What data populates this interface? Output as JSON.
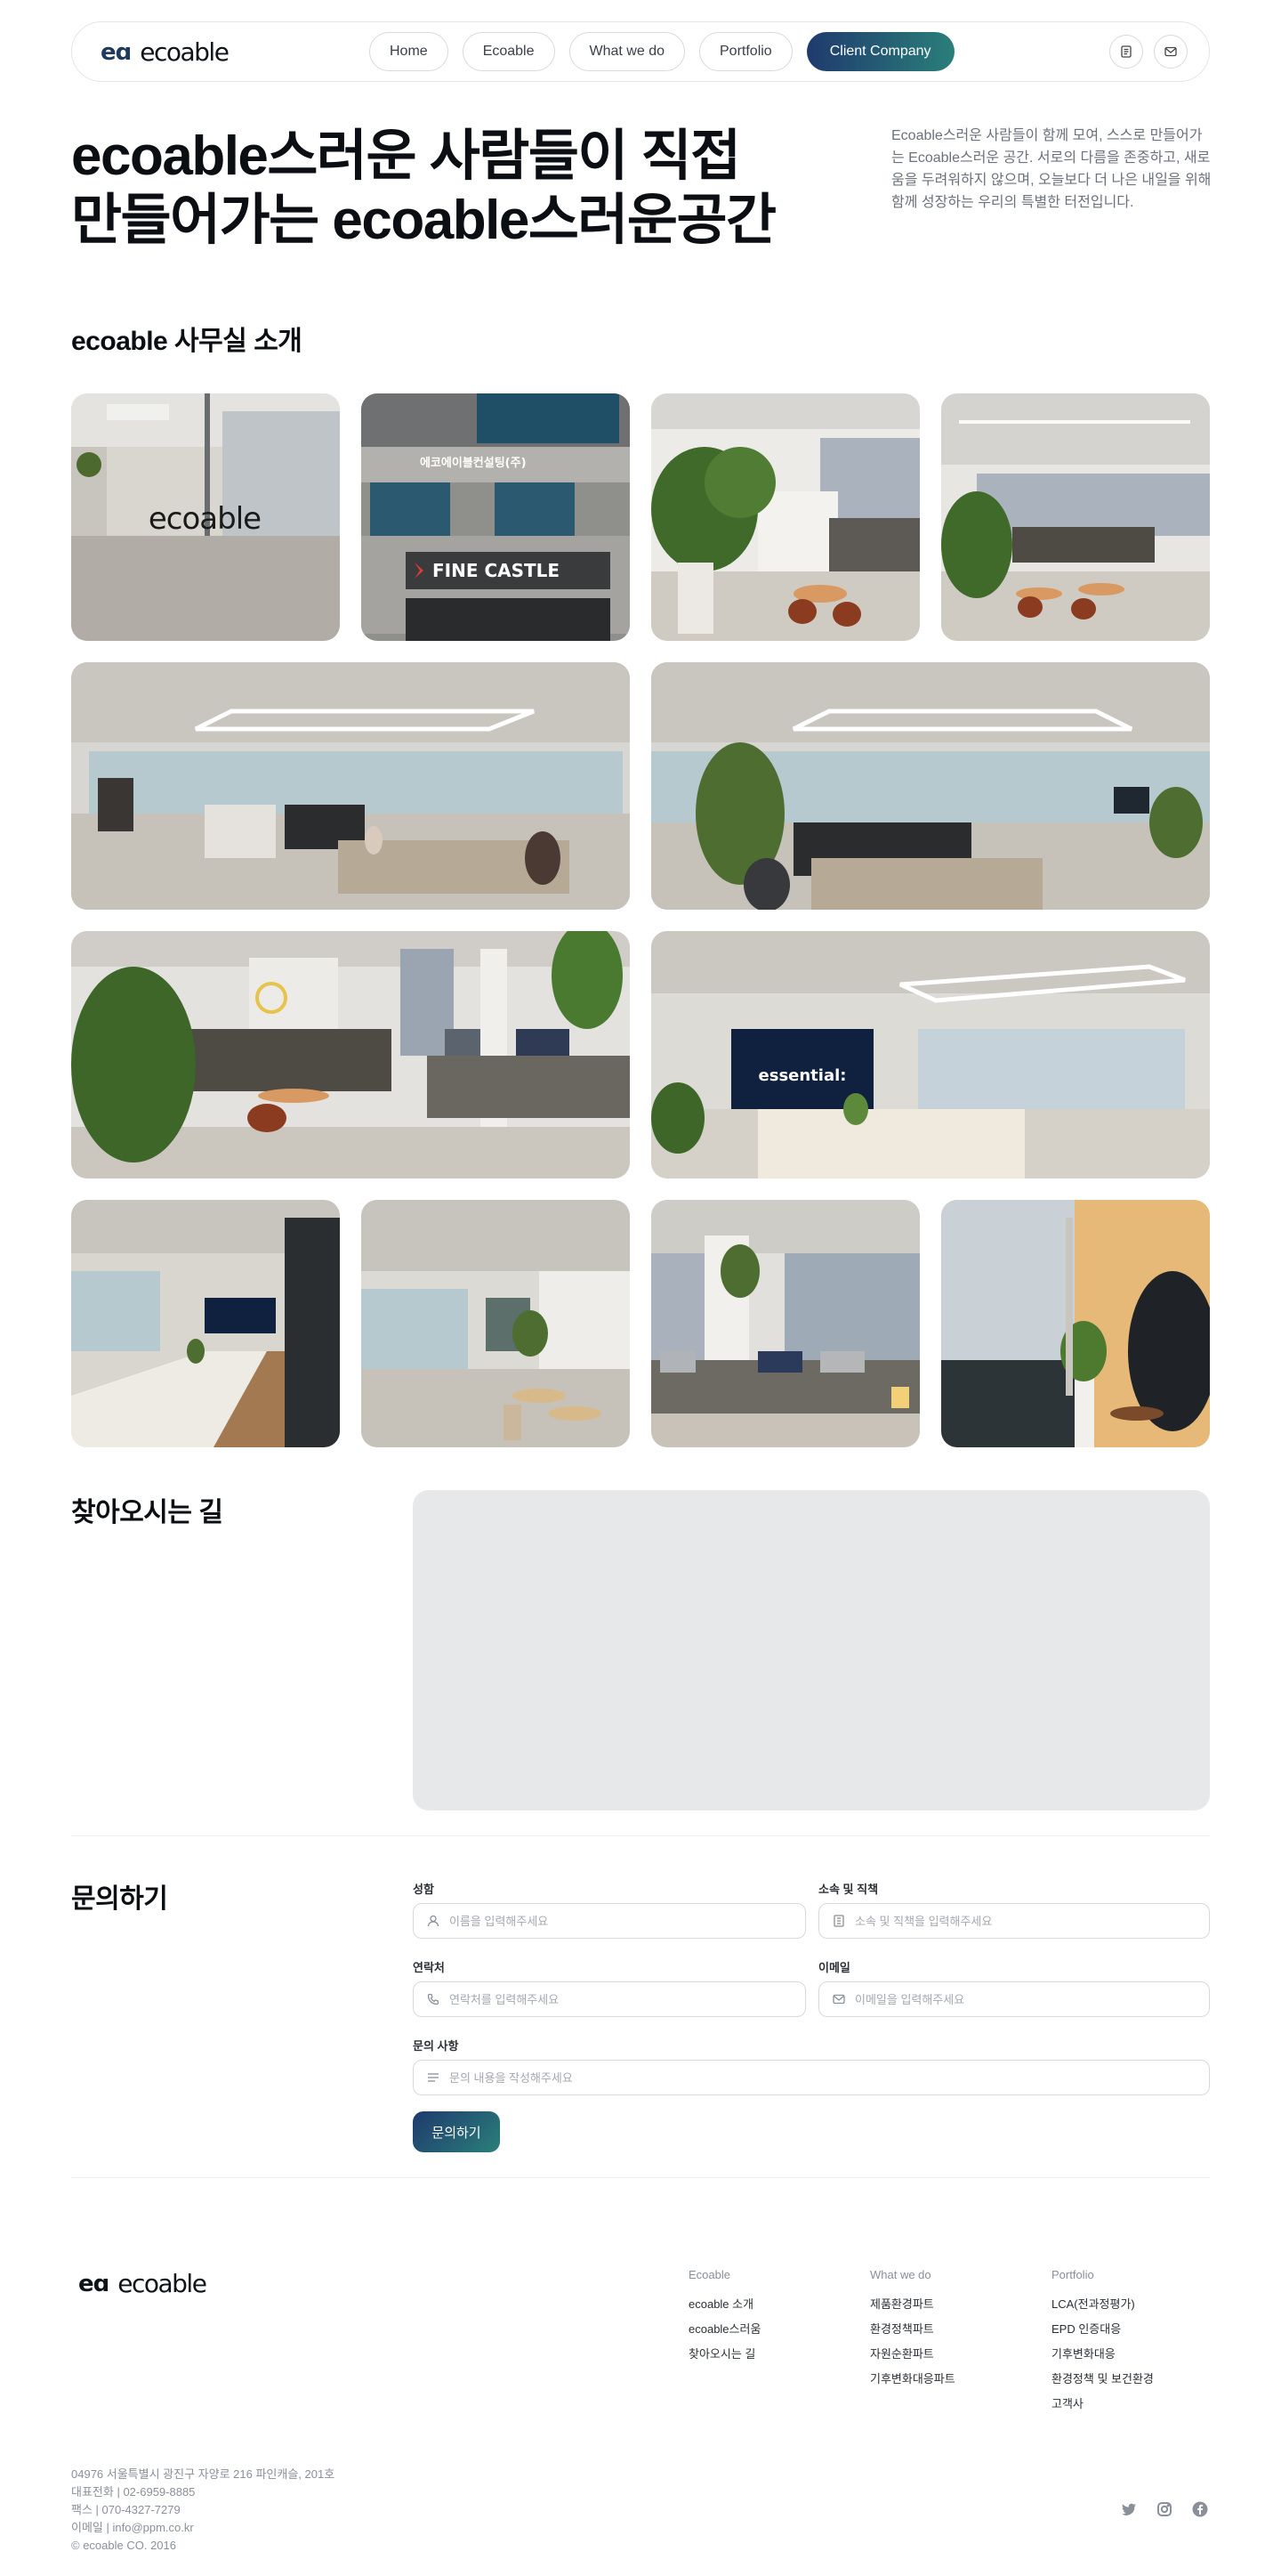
{
  "brand": {
    "mark": "eɑ",
    "name": "ecoable"
  },
  "nav": {
    "items": [
      "Home",
      "Ecoable",
      "What we do",
      "Portfolio",
      "Client Company"
    ],
    "active_index": 4
  },
  "hero": {
    "title_line1": "ecoable스러운 사람들이 직접",
    "title_line2": "만들어가는 ecoable스러운공간",
    "description": "Ecoable스러운 사람들이 함께 모여, 스스로 만들어가는 Ecoable스러운 공간. 서로의 다름을 존중하고, 새로움을 두려워하지 않으며, 오늘보다 더 나은 내일을 위해 함께 성장하는 우리의 특별한 터전입니다."
  },
  "office": {
    "title": "ecoable 사무실 소개",
    "photos": [
      "office-entrance-logo-wall",
      "building-exterior-signage",
      "lounge-plants-cafe",
      "lounge-wide-view",
      "open-office-desks-left",
      "open-office-desks-right",
      "lounge-seating-plants",
      "meeting-room-tv",
      "meeting-room-long-table",
      "office-corridor-view",
      "lounge-sofa-bench",
      "massage-chair-corner"
    ],
    "signs": {
      "entrance_logo": "ecoable",
      "building_sign": "에코에이블컨설팅(주)",
      "store_sign": "FINE CASTLE",
      "tv_screen": "essential:"
    }
  },
  "directions": {
    "title": "찾아오시는 길"
  },
  "inquiry": {
    "title": "문의하기",
    "fields": {
      "name": {
        "label": "성함",
        "placeholder": "이름을 입력해주세요"
      },
      "affiliation": {
        "label": "소속 및 직책",
        "placeholder": "소속 및 직책을 입력해주세요"
      },
      "phone": {
        "label": "연락처",
        "placeholder": "연락처를 입력해주세요"
      },
      "email": {
        "label": "이메일",
        "placeholder": "이메일을 입력해주세요"
      },
      "message": {
        "label": "문의 사항",
        "placeholder": "문의 내용을 작성해주세요"
      }
    },
    "submit_label": "문의하기"
  },
  "footer": {
    "columns": [
      {
        "head": "Ecoable",
        "items": [
          "ecoable 소개",
          "ecoable스러움",
          "찾아오시는 길"
        ]
      },
      {
        "head": "What we do",
        "items": [
          "제품환경파트",
          "환경정책파트",
          "자원순환파트",
          "기후변화대응파트"
        ]
      },
      {
        "head": "Portfolio",
        "items": [
          "LCA(전과정평가)",
          "EPD 인증대응",
          "기후변화대응",
          "환경정책 및 보건환경",
          "고객사"
        ]
      }
    ],
    "info": [
      "04976 서울특별시 광진구 자양로 216 파인캐슬, 201호",
      "대표전화 | 02-6959-8885",
      "팩스 | 070-4327-7279",
      "이메일 | info@ppm.co.kr",
      "© ecoable CO. 2016"
    ],
    "social": [
      "twitter-icon",
      "instagram-icon",
      "facebook-icon"
    ]
  },
  "colors": {
    "accent_start": "#1f3a6d",
    "accent_end": "#2a7f7a",
    "map_bg": "#e7e8ea"
  }
}
